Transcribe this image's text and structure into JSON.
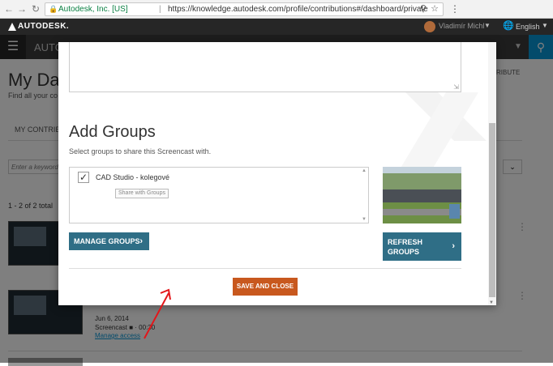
{
  "browser": {
    "back_icon": "arrow-left-icon",
    "forward_icon": "arrow-right-icon",
    "reload_icon": "reload-icon",
    "secure_site": "Autodesk, Inc. [US]",
    "url": "https://knowledge.autodesk.com/profile/contributions#/dashboard/private",
    "url_separator": "|"
  },
  "topbar": {
    "logo_text": "AUTODESK.",
    "user_name": "Vladimír Michl",
    "language": "English"
  },
  "header": {
    "brand_partial": "AUTO"
  },
  "page": {
    "title_partial": "My Das",
    "subtitle_partial": "Find all your co",
    "contrib_right": "RIBUTE",
    "tab_contrib": "MY CONTRIB",
    "filter_placeholder": "Enter a keyword",
    "result_count": "1 - 2 of 2 total",
    "item2_date": "Jun 6, 2014",
    "item2_type": "Screencast ■ · 00:30",
    "manage_access": "Manage access"
  },
  "modal": {
    "add_groups_title": "Add Groups",
    "groups_hint": "Select groups to share this Screencast with.",
    "groups": [
      {
        "name": "CAD Studio - kolegové",
        "checked": true,
        "share_label": "Share with Groups"
      }
    ],
    "manage_groups_label": "MANAGE GROUPS",
    "refresh_groups_label_line1": "REFRESH",
    "refresh_groups_label_line2": "GROUPS",
    "save_label": "SAVE AND CLOSE"
  },
  "colors": {
    "accent_teal": "#2f6e86",
    "save_orange": "#c8581e",
    "search_blue": "#0696d7",
    "annotation_red": "#e3161a"
  }
}
